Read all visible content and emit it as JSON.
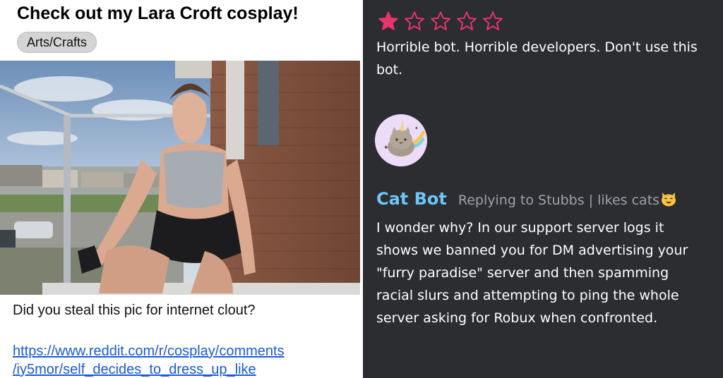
{
  "post": {
    "title": "Check out my Lara Croft cosplay!",
    "tag": "Arts/Crafts",
    "photo_alt": "cosplay-photo",
    "comment": "Did you steal this pic for internet clout?",
    "link_lines": [
      "https://www.reddit.com/r/cosplay/comments",
      "/iy5mor/self_decides_to_dress_up_like"
    ]
  },
  "review": {
    "rating": 1,
    "max_rating": 5,
    "star_color": "#e8336d",
    "lines": [
      "Horrible bot. Horrible developers. Don't use this",
      "bot."
    ]
  },
  "reply": {
    "author": "Cat Bot",
    "author_color": "#6ec6f5",
    "meta": "Replying to Stubbs | likes cats",
    "meta_icon": "cat-face-emoji",
    "lines": [
      "I wonder why? In our support server logs it",
      "shows we banned you for DM advertising your",
      "\"furry paradise\" server and then spamming",
      "racial slurs and attempting to ping the whole",
      "server asking for Robux when confronted."
    ]
  }
}
